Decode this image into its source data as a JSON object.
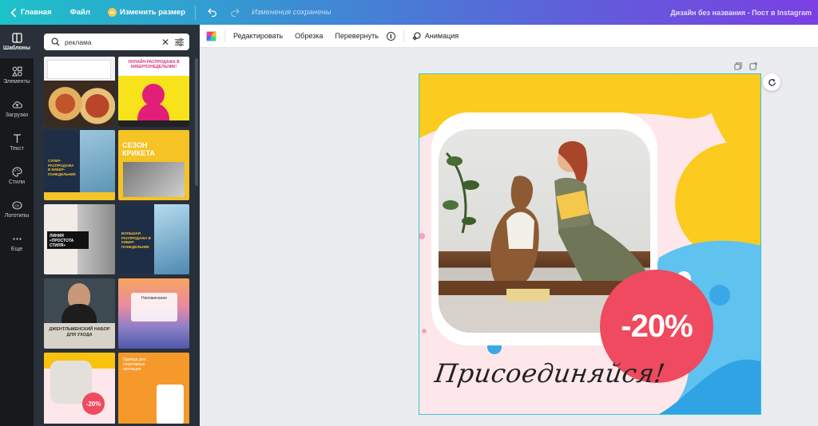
{
  "topbar": {
    "home": "Главная",
    "file": "Файл",
    "resize": "Изменить размер",
    "saved_status": "Изменения сохранены",
    "document_name": "Дизайн без названия - Пост в Instagram"
  },
  "rail": {
    "items": [
      {
        "label": "Шаблоны",
        "icon": "layout-icon"
      },
      {
        "label": "Элементы",
        "icon": "shapes-icon"
      },
      {
        "label": "Загрузки",
        "icon": "cloud-upload-icon"
      },
      {
        "label": "Текст",
        "icon": "text-icon"
      },
      {
        "label": "Стили",
        "icon": "palette-icon"
      },
      {
        "label": "Логотипы",
        "icon": "logo-icon"
      },
      {
        "label": "Еще",
        "icon": "more-icon"
      }
    ]
  },
  "panel": {
    "search_value": "реклама",
    "templates": [
      {
        "text": ""
      },
      {
        "text": "ОНЛАЙН-РАСПРОДАЖА В КИБЕРПОНЕДЕЛЬНИК!"
      },
      {
        "text": "СУПЕР-РАСПРОДАЖА В КИБЕР-ПОНЕДЕЛЬНИК"
      },
      {
        "text": "СЕЗОН КРИКЕТА"
      },
      {
        "text": "ЛИНИЯ «ПРОСТОТА СТИЛЯ»"
      },
      {
        "text": "БОЛЬШАЯ РАСПРОДАЖА В КИБЕР-ПОНЕДЕЛЬНИК"
      },
      {
        "text": "ДЖЕНТЛЬМЕНСКИЙ НАБОР ДЛЯ УХОДА"
      },
      {
        "text": "Напоминание"
      },
      {
        "text": "-20%"
      },
      {
        "text": "Одежда для спортивных питомцев"
      }
    ]
  },
  "toolbar": {
    "edit": "Редактировать",
    "crop": "Обрезка",
    "flip": "Перевернуть",
    "info": "i",
    "animation": "Анимация"
  },
  "design": {
    "discount": "-20%",
    "signature": "Присоединяйся!"
  }
}
